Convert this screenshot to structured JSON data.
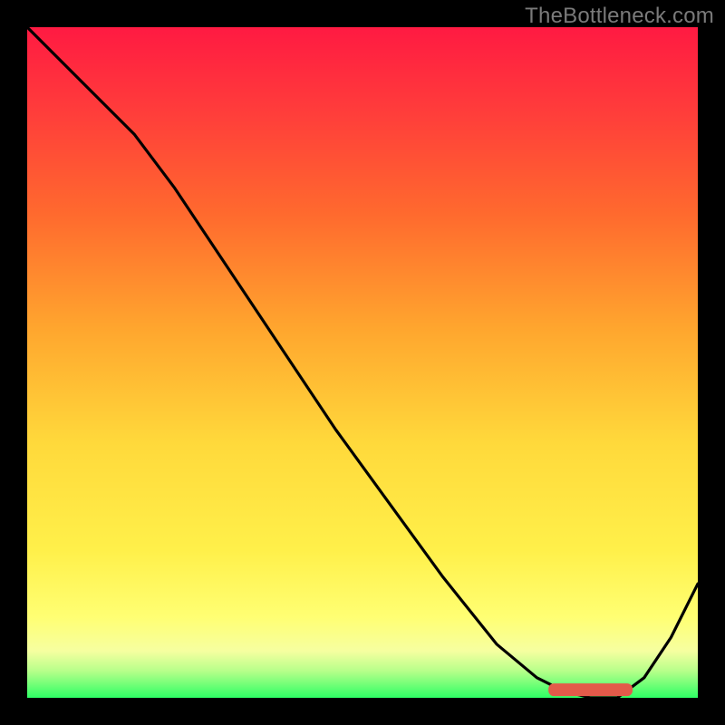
{
  "watermark": "TheBottleneck.com",
  "colors": {
    "background": "#000000",
    "curve": "#000000",
    "marker": "#e35a4a"
  },
  "chart_data": {
    "type": "line",
    "title": "",
    "xlabel": "",
    "ylabel": "",
    "xlim": [
      0,
      100
    ],
    "ylim": [
      0,
      100
    ],
    "series": [
      {
        "name": "curve",
        "x": [
          0,
          8,
          16,
          22,
          30,
          38,
          46,
          54,
          62,
          70,
          76,
          80,
          84,
          88,
          92,
          96,
          100
        ],
        "y": [
          100,
          92,
          84,
          76,
          64,
          52,
          40,
          29,
          18,
          8,
          3,
          1,
          0,
          0,
          3,
          9,
          17
        ]
      }
    ],
    "annotation": {
      "name": "min-region",
      "x_start": 78,
      "x_end": 90,
      "y": 1.2
    },
    "gradient_stops": [
      {
        "pos": 0.0,
        "color": "#ff1a42"
      },
      {
        "pos": 0.45,
        "color": "#ffa62e"
      },
      {
        "pos": 0.78,
        "color": "#fff04a"
      },
      {
        "pos": 1.0,
        "color": "#2eff65"
      }
    ]
  }
}
